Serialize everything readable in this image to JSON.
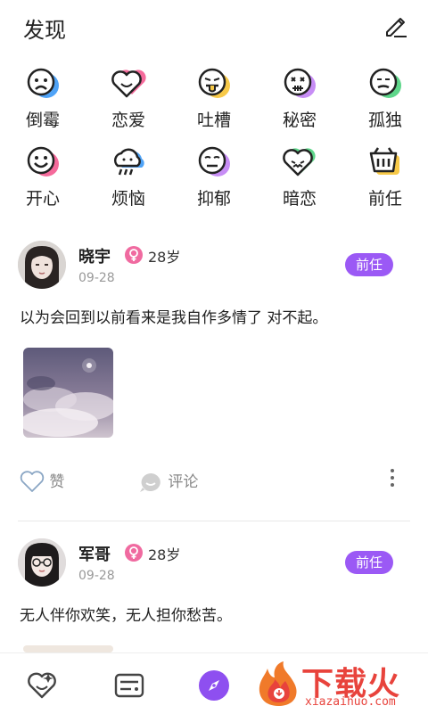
{
  "header": {
    "title": "发现"
  },
  "moods": [
    {
      "label": "倒霉",
      "icon": "sad-face-icon",
      "accent": "#4fa3f7"
    },
    {
      "label": "恋爱",
      "icon": "heart-face-icon",
      "accent": "#f56a9b"
    },
    {
      "label": "吐槽",
      "icon": "tongue-face-icon",
      "accent": "#f7c948"
    },
    {
      "label": "秘密",
      "icon": "secret-face-icon",
      "accent": "#c78df5"
    },
    {
      "label": "孤独",
      "icon": "lonely-face-icon",
      "accent": "#5ed68a"
    },
    {
      "label": "开心",
      "icon": "happy-face-icon",
      "accent": "#f56a9b"
    },
    {
      "label": "烦恼",
      "icon": "rain-cloud-icon",
      "accent": "#4fa3f7"
    },
    {
      "label": "抑郁",
      "icon": "depressed-face-icon",
      "accent": "#c78df5"
    },
    {
      "label": "暗恋",
      "icon": "crush-heart-icon",
      "accent": "#5ed68a"
    },
    {
      "label": "前任",
      "icon": "basket-icon",
      "accent": "#f7c948"
    }
  ],
  "posts": [
    {
      "name": "晓宇",
      "age": "28岁",
      "date": "09-28",
      "tag": "前任",
      "text": "以为会回到以前看来是我自作多情了 对不起。",
      "like_label": "赞",
      "comment_label": "评论"
    },
    {
      "name": "军哥",
      "age": "28岁",
      "date": "09-28",
      "tag": "前任",
      "text": "无人伴你欢笑，无人担你愁苦。"
    }
  ],
  "tabbar": {
    "items": [
      "heart-tab-icon",
      "card-tab-icon",
      "compass-tab-icon"
    ]
  },
  "watermark": {
    "text": "下载火",
    "url": "xiazaihuo.com"
  },
  "colors": {
    "accent": "#9b59f5",
    "female": "#f06aa0"
  }
}
